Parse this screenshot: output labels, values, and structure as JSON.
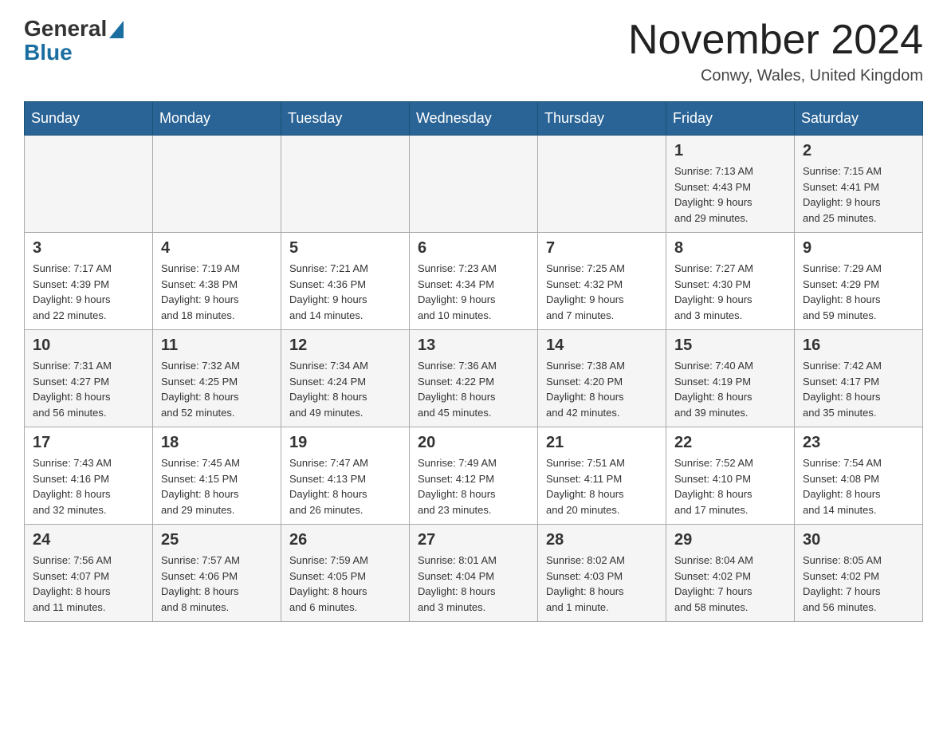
{
  "header": {
    "logo_general": "General",
    "logo_blue": "Blue",
    "month_title": "November 2024",
    "location": "Conwy, Wales, United Kingdom"
  },
  "weekdays": [
    "Sunday",
    "Monday",
    "Tuesday",
    "Wednesday",
    "Thursday",
    "Friday",
    "Saturday"
  ],
  "weeks": [
    [
      {
        "day": "",
        "info": ""
      },
      {
        "day": "",
        "info": ""
      },
      {
        "day": "",
        "info": ""
      },
      {
        "day": "",
        "info": ""
      },
      {
        "day": "",
        "info": ""
      },
      {
        "day": "1",
        "info": "Sunrise: 7:13 AM\nSunset: 4:43 PM\nDaylight: 9 hours\nand 29 minutes."
      },
      {
        "day": "2",
        "info": "Sunrise: 7:15 AM\nSunset: 4:41 PM\nDaylight: 9 hours\nand 25 minutes."
      }
    ],
    [
      {
        "day": "3",
        "info": "Sunrise: 7:17 AM\nSunset: 4:39 PM\nDaylight: 9 hours\nand 22 minutes."
      },
      {
        "day": "4",
        "info": "Sunrise: 7:19 AM\nSunset: 4:38 PM\nDaylight: 9 hours\nand 18 minutes."
      },
      {
        "day": "5",
        "info": "Sunrise: 7:21 AM\nSunset: 4:36 PM\nDaylight: 9 hours\nand 14 minutes."
      },
      {
        "day": "6",
        "info": "Sunrise: 7:23 AM\nSunset: 4:34 PM\nDaylight: 9 hours\nand 10 minutes."
      },
      {
        "day": "7",
        "info": "Sunrise: 7:25 AM\nSunset: 4:32 PM\nDaylight: 9 hours\nand 7 minutes."
      },
      {
        "day": "8",
        "info": "Sunrise: 7:27 AM\nSunset: 4:30 PM\nDaylight: 9 hours\nand 3 minutes."
      },
      {
        "day": "9",
        "info": "Sunrise: 7:29 AM\nSunset: 4:29 PM\nDaylight: 8 hours\nand 59 minutes."
      }
    ],
    [
      {
        "day": "10",
        "info": "Sunrise: 7:31 AM\nSunset: 4:27 PM\nDaylight: 8 hours\nand 56 minutes."
      },
      {
        "day": "11",
        "info": "Sunrise: 7:32 AM\nSunset: 4:25 PM\nDaylight: 8 hours\nand 52 minutes."
      },
      {
        "day": "12",
        "info": "Sunrise: 7:34 AM\nSunset: 4:24 PM\nDaylight: 8 hours\nand 49 minutes."
      },
      {
        "day": "13",
        "info": "Sunrise: 7:36 AM\nSunset: 4:22 PM\nDaylight: 8 hours\nand 45 minutes."
      },
      {
        "day": "14",
        "info": "Sunrise: 7:38 AM\nSunset: 4:20 PM\nDaylight: 8 hours\nand 42 minutes."
      },
      {
        "day": "15",
        "info": "Sunrise: 7:40 AM\nSunset: 4:19 PM\nDaylight: 8 hours\nand 39 minutes."
      },
      {
        "day": "16",
        "info": "Sunrise: 7:42 AM\nSunset: 4:17 PM\nDaylight: 8 hours\nand 35 minutes."
      }
    ],
    [
      {
        "day": "17",
        "info": "Sunrise: 7:43 AM\nSunset: 4:16 PM\nDaylight: 8 hours\nand 32 minutes."
      },
      {
        "day": "18",
        "info": "Sunrise: 7:45 AM\nSunset: 4:15 PM\nDaylight: 8 hours\nand 29 minutes."
      },
      {
        "day": "19",
        "info": "Sunrise: 7:47 AM\nSunset: 4:13 PM\nDaylight: 8 hours\nand 26 minutes."
      },
      {
        "day": "20",
        "info": "Sunrise: 7:49 AM\nSunset: 4:12 PM\nDaylight: 8 hours\nand 23 minutes."
      },
      {
        "day": "21",
        "info": "Sunrise: 7:51 AM\nSunset: 4:11 PM\nDaylight: 8 hours\nand 20 minutes."
      },
      {
        "day": "22",
        "info": "Sunrise: 7:52 AM\nSunset: 4:10 PM\nDaylight: 8 hours\nand 17 minutes."
      },
      {
        "day": "23",
        "info": "Sunrise: 7:54 AM\nSunset: 4:08 PM\nDaylight: 8 hours\nand 14 minutes."
      }
    ],
    [
      {
        "day": "24",
        "info": "Sunrise: 7:56 AM\nSunset: 4:07 PM\nDaylight: 8 hours\nand 11 minutes."
      },
      {
        "day": "25",
        "info": "Sunrise: 7:57 AM\nSunset: 4:06 PM\nDaylight: 8 hours\nand 8 minutes."
      },
      {
        "day": "26",
        "info": "Sunrise: 7:59 AM\nSunset: 4:05 PM\nDaylight: 8 hours\nand 6 minutes."
      },
      {
        "day": "27",
        "info": "Sunrise: 8:01 AM\nSunset: 4:04 PM\nDaylight: 8 hours\nand 3 minutes."
      },
      {
        "day": "28",
        "info": "Sunrise: 8:02 AM\nSunset: 4:03 PM\nDaylight: 8 hours\nand 1 minute."
      },
      {
        "day": "29",
        "info": "Sunrise: 8:04 AM\nSunset: 4:02 PM\nDaylight: 7 hours\nand 58 minutes."
      },
      {
        "day": "30",
        "info": "Sunrise: 8:05 AM\nSunset: 4:02 PM\nDaylight: 7 hours\nand 56 minutes."
      }
    ]
  ]
}
